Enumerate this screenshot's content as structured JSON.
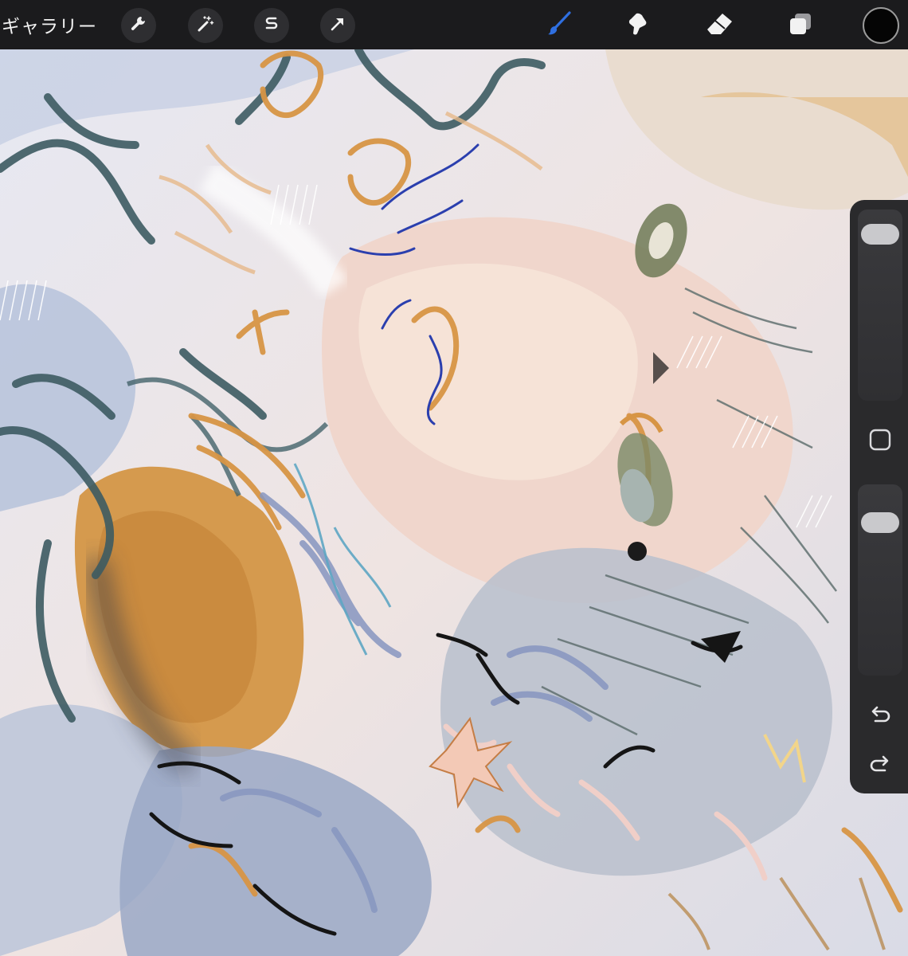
{
  "topbar": {
    "gallery_label": "ギャラリー",
    "left_tools": [
      {
        "name": "wrench-icon"
      },
      {
        "name": "magic-wand-icon"
      },
      {
        "name": "selection-icon"
      },
      {
        "name": "move-arrow-icon"
      }
    ],
    "right_tools": [
      {
        "name": "brush-icon",
        "active_color": "#2f6fe0"
      },
      {
        "name": "smudge-icon"
      },
      {
        "name": "eraser-icon"
      },
      {
        "name": "layers-icon"
      }
    ],
    "current_color": "#050505"
  },
  "sidebar": {
    "brush_size_level": 0.93,
    "opacity_level": 0.85,
    "icons": [
      "modify-square-icon",
      "undo-icon",
      "redo-icon"
    ]
  },
  "artwork": {
    "palette": [
      "#e9b06a",
      "#d08d3a",
      "#3f5f66",
      "#7b8fb8",
      "#2c3fa8",
      "#f1dcd8",
      "#1a1a1a",
      "#8a9c9c"
    ]
  }
}
